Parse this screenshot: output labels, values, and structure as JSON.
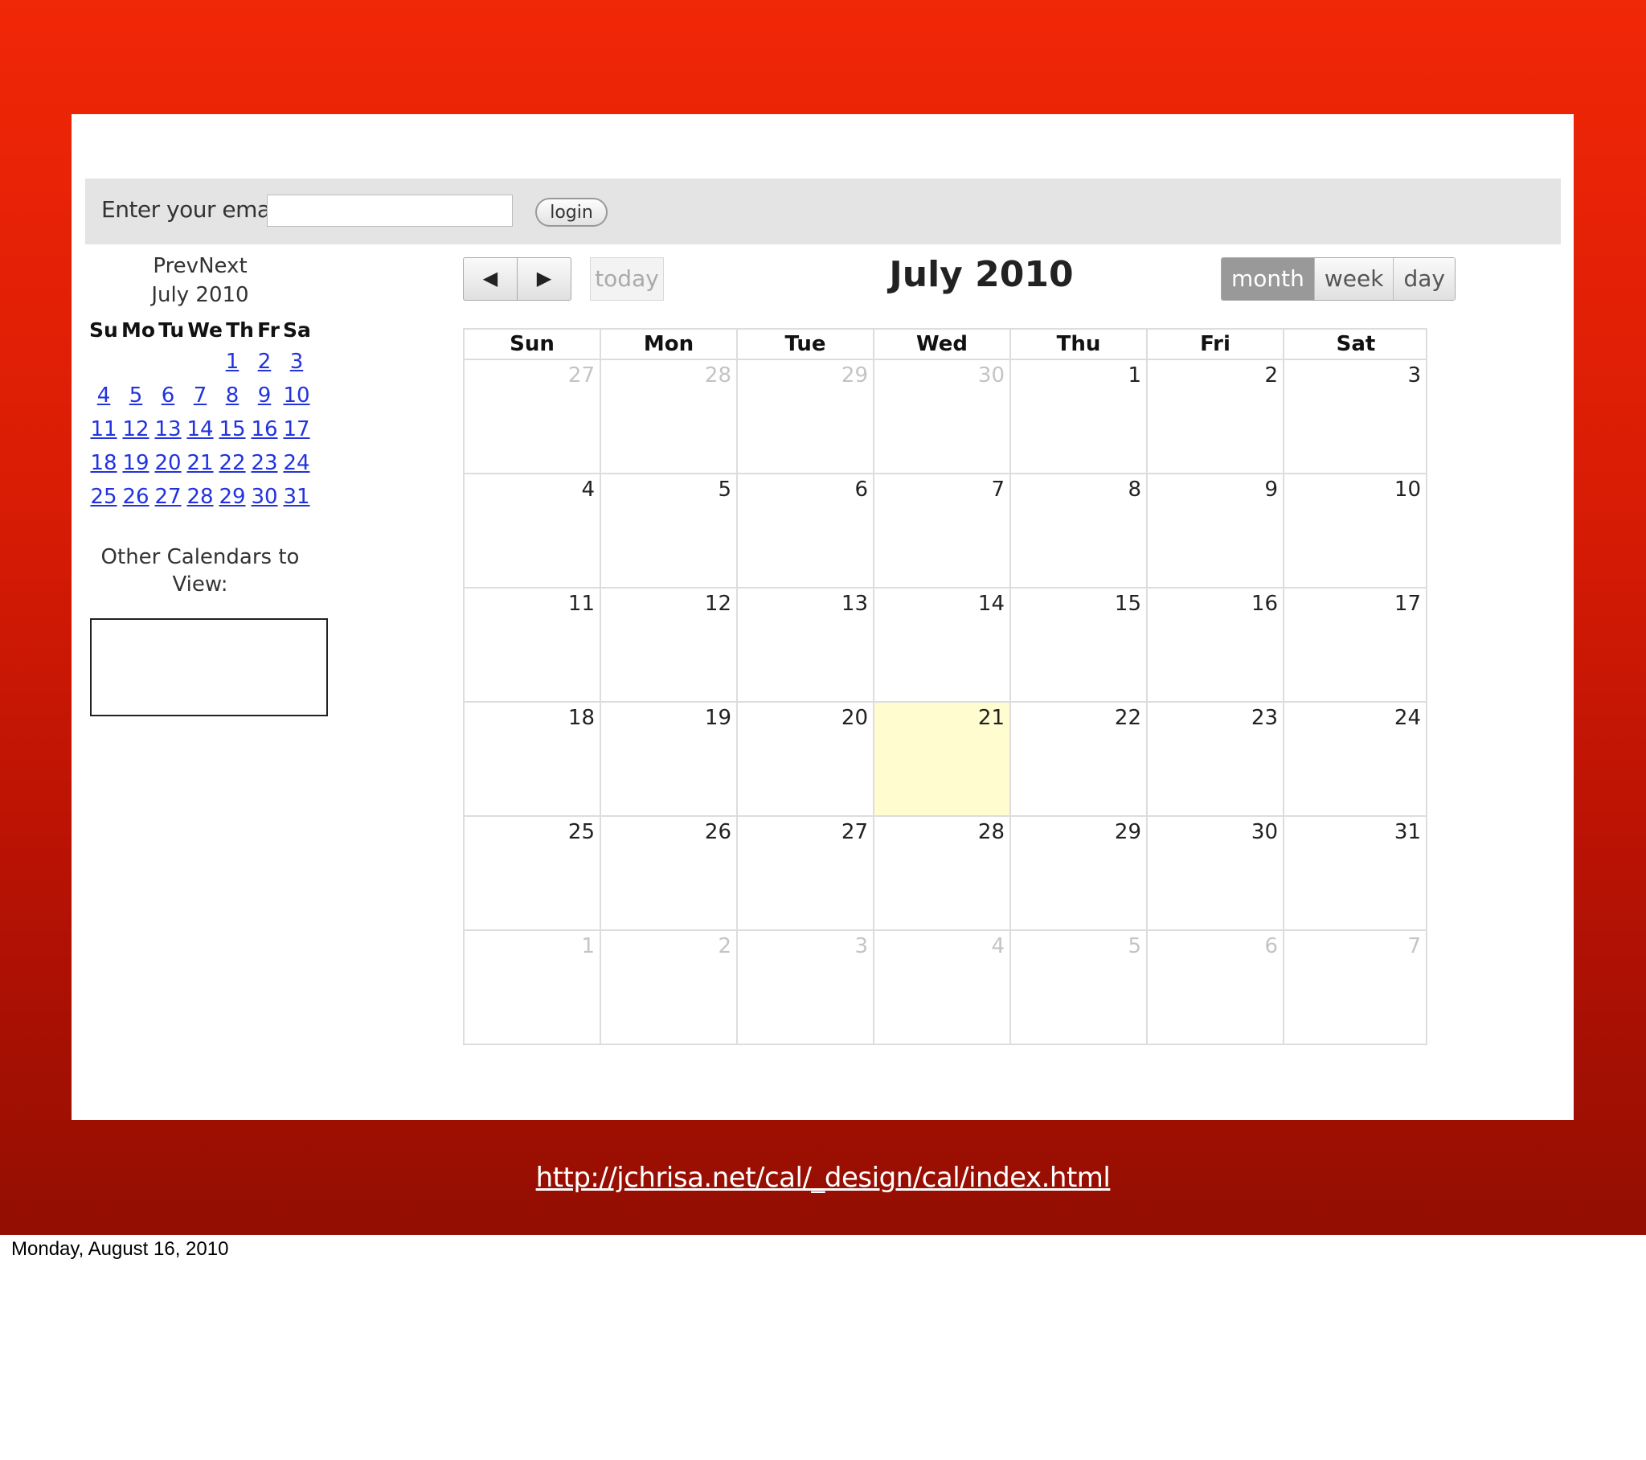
{
  "login": {
    "label": "Enter your email",
    "email_value": "",
    "button": "login"
  },
  "mini_calendar": {
    "nav": "PrevNext",
    "title": "July 2010",
    "weekdays": [
      "Su",
      "Mo",
      "Tu",
      "We",
      "Th",
      "Fr",
      "Sa"
    ],
    "weeks": [
      [
        "",
        "",
        "",
        "",
        "1",
        "2",
        "3"
      ],
      [
        "4",
        "5",
        "6",
        "7",
        "8",
        "9",
        "10"
      ],
      [
        "11",
        "12",
        "13",
        "14",
        "15",
        "16",
        "17"
      ],
      [
        "18",
        "19",
        "20",
        "21",
        "22",
        "23",
        "24"
      ],
      [
        "25",
        "26",
        "27",
        "28",
        "29",
        "30",
        "31"
      ]
    ]
  },
  "other_calendars": {
    "label": "Other Calendars to View:"
  },
  "toolbar": {
    "prev_icon": "◀",
    "next_icon": "▶",
    "today": "today",
    "title": "July 2010",
    "views": [
      "month",
      "week",
      "day"
    ],
    "active_view": "month"
  },
  "calendar": {
    "weekdays": [
      "Sun",
      "Mon",
      "Tue",
      "Wed",
      "Thu",
      "Fri",
      "Sat"
    ],
    "today": "21",
    "weeks": [
      [
        {
          "d": "27",
          "o": true
        },
        {
          "d": "28",
          "o": true
        },
        {
          "d": "29",
          "o": true
        },
        {
          "d": "30",
          "o": true
        },
        {
          "d": "1"
        },
        {
          "d": "2"
        },
        {
          "d": "3"
        }
      ],
      [
        {
          "d": "4"
        },
        {
          "d": "5"
        },
        {
          "d": "6"
        },
        {
          "d": "7"
        },
        {
          "d": "8"
        },
        {
          "d": "9"
        },
        {
          "d": "10"
        }
      ],
      [
        {
          "d": "11"
        },
        {
          "d": "12"
        },
        {
          "d": "13"
        },
        {
          "d": "14"
        },
        {
          "d": "15"
        },
        {
          "d": "16"
        },
        {
          "d": "17"
        }
      ],
      [
        {
          "d": "18"
        },
        {
          "d": "19"
        },
        {
          "d": "20"
        },
        {
          "d": "21"
        },
        {
          "d": "22"
        },
        {
          "d": "23"
        },
        {
          "d": "24"
        }
      ],
      [
        {
          "d": "25"
        },
        {
          "d": "26"
        },
        {
          "d": "27"
        },
        {
          "d": "28"
        },
        {
          "d": "29"
        },
        {
          "d": "30"
        },
        {
          "d": "31"
        }
      ],
      [
        {
          "d": "1",
          "o": true
        },
        {
          "d": "2",
          "o": true
        },
        {
          "d": "3",
          "o": true
        },
        {
          "d": "4",
          "o": true
        },
        {
          "d": "5",
          "o": true
        },
        {
          "d": "6",
          "o": true
        },
        {
          "d": "7",
          "o": true
        }
      ]
    ]
  },
  "url": "http://jchrisa.net/cal/_design/cal/index.html",
  "footer_date": "Monday, August 16, 2010",
  "colors": {
    "slide_top": "#f12707",
    "slide_bottom": "#930e02",
    "today_highlight": "#fffdd0",
    "link": "#2233dd"
  }
}
